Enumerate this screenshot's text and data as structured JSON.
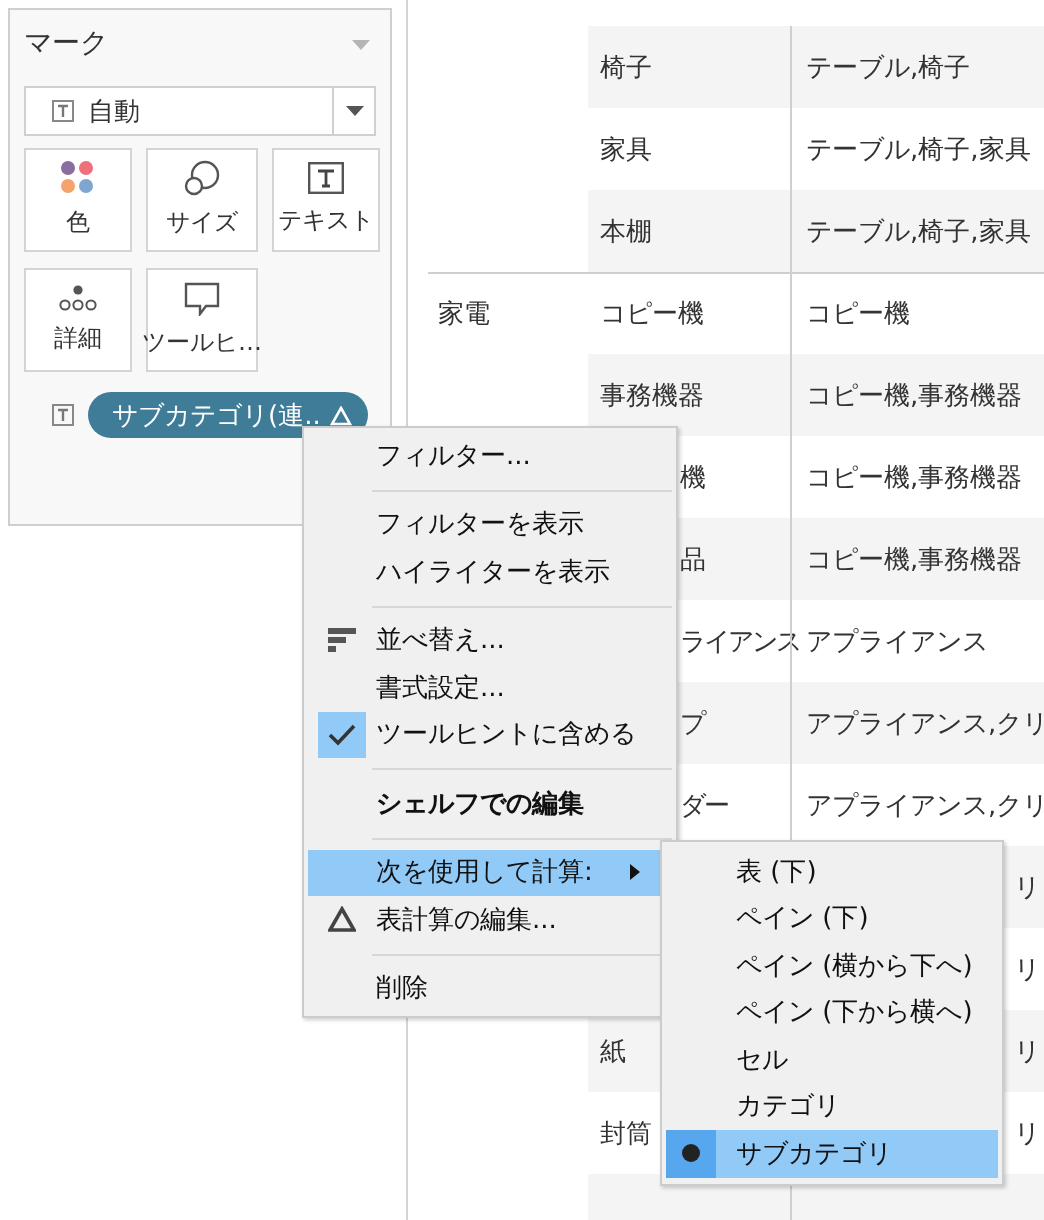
{
  "marks_card": {
    "title": "マーク",
    "mark_type": {
      "label": "自動"
    },
    "buttons": [
      {
        "label": "色",
        "kind": "color"
      },
      {
        "label": "サイズ",
        "kind": "size"
      },
      {
        "label": "テキスト",
        "kind": "text"
      },
      {
        "label": "詳細",
        "kind": "detail"
      },
      {
        "label": "ツールヒ…",
        "kind": "tooltip"
      }
    ],
    "pills": [
      {
        "label": "サブカテゴリ(連..",
        "kind": "text"
      }
    ]
  },
  "table": {
    "rows": [
      {
        "subcategory": "椅子",
        "value": "テーブル,椅子",
        "sub_clipped": false,
        "value_clipped": false
      },
      {
        "subcategory": "家具",
        "value": "テーブル,椅子,家具",
        "sub_clipped": false,
        "value_clipped": false
      },
      {
        "subcategory": "本棚",
        "value": "テーブル,椅子,家具",
        "sub_clipped": false,
        "value_clipped": false
      },
      {
        "category": "家電",
        "group_start": true,
        "subcategory": "コピー機",
        "value": "コピー機",
        "sub_clipped": false,
        "value_clipped": false
      },
      {
        "subcategory": "事務機器",
        "value": "コピー機,事務機器",
        "sub_clipped": false,
        "value_clipped": false
      },
      {
        "subcategory": "機",
        "value": "コピー機,事務機器",
        "sub_clipped": true,
        "value_clipped": false
      },
      {
        "subcategory": "品",
        "value": "コピー機,事務機器",
        "sub_clipped": true,
        "value_clipped": false
      },
      {
        "subcategory": "ライアンス",
        "value": "アプライアンス",
        "sub_clipped": true,
        "value_clipped": false
      },
      {
        "subcategory": "プ",
        "value": "アプライアンス,クリ",
        "sub_clipped": true,
        "value_clipped": false
      },
      {
        "subcategory": "ダー",
        "value": "アプライアンス,クリ",
        "sub_clipped": true,
        "value_clipped": false
      },
      {
        "value": "リ",
        "value_clipped": true
      },
      {
        "value": "リ",
        "value_clipped": true
      },
      {
        "subcategory": "紙",
        "value": "リ",
        "sub_clipped": false,
        "value_clipped": true
      },
      {
        "subcategory": "封筒",
        "value": "リ",
        "sub_clipped": false,
        "value_clipped": true
      }
    ]
  },
  "context_menu": {
    "groups": [
      [
        {
          "label": "フィルター...",
          "kind": "plain",
          "highlighted": false
        }
      ],
      [
        {
          "label": "フィルターを表示",
          "kind": "plain",
          "highlighted": false
        },
        {
          "label": "ハイライターを表示",
          "kind": "plain",
          "highlighted": false
        }
      ],
      [
        {
          "label": "並べ替え...",
          "kind": "sort",
          "highlighted": false
        },
        {
          "label": "書式設定...",
          "kind": "plain",
          "highlighted": false
        },
        {
          "label": "ツールヒントに含める",
          "kind": "toggle",
          "checked": true,
          "highlighted": false
        }
      ],
      [
        {
          "label": "シェルフでの編集",
          "kind": "heading",
          "highlighted": false
        }
      ],
      [
        {
          "label": "次を使用して計算:",
          "kind": "submenu",
          "highlighted": true
        },
        {
          "label": "表計算の編集...",
          "kind": "table-calc",
          "highlighted": false
        }
      ],
      [
        {
          "label": "削除",
          "kind": "plain",
          "highlighted": false
        }
      ]
    ]
  },
  "submenu": {
    "items": [
      {
        "label": "表 (下)",
        "selected": false
      },
      {
        "label": "ペイン (下)",
        "selected": false
      },
      {
        "label": "ペイン (横から下へ)",
        "selected": false
      },
      {
        "label": "ペイン (下から横へ)",
        "selected": false
      },
      {
        "label": "セル",
        "selected": false
      },
      {
        "label": "カテゴリ",
        "selected": false
      },
      {
        "label": "サブカテゴリ",
        "selected": true
      }
    ]
  }
}
